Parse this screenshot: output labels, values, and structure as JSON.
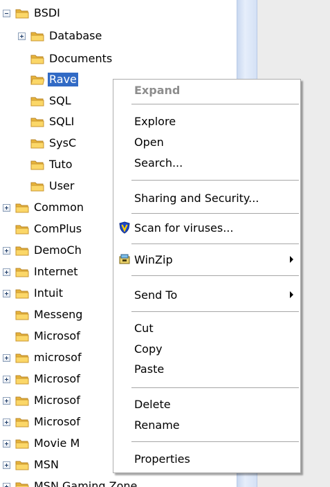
{
  "tree": {
    "items": [
      {
        "label": "BSDI",
        "expander": "minus"
      },
      {
        "label": "Database",
        "expander": "plus"
      },
      {
        "label": "Documents",
        "expander": "none"
      },
      {
        "label": "Rave",
        "expander": "none",
        "selected": true
      },
      {
        "label": "SQL",
        "expander": "none"
      },
      {
        "label": "SQLI",
        "expander": "none"
      },
      {
        "label": "SysC",
        "expander": "none"
      },
      {
        "label": "Tuto",
        "expander": "none"
      },
      {
        "label": "User",
        "expander": "none"
      },
      {
        "label": "Common",
        "expander": "plus"
      },
      {
        "label": "ComPlus",
        "expander": "none"
      },
      {
        "label": "DemoCh",
        "expander": "plus"
      },
      {
        "label": "Internet",
        "expander": "plus"
      },
      {
        "label": "Intuit",
        "expander": "plus"
      },
      {
        "label": "Messeng",
        "expander": "none"
      },
      {
        "label": "Microsof",
        "expander": "none"
      },
      {
        "label": "microsof",
        "expander": "plus"
      },
      {
        "label": "Microsof",
        "expander": "plus"
      },
      {
        "label": "Microsof",
        "expander": "plus"
      },
      {
        "label": "Microsof",
        "expander": "plus"
      },
      {
        "label": "Movie M",
        "expander": "plus"
      },
      {
        "label": "MSN",
        "expander": "plus"
      },
      {
        "label": "MSN Gaming Zone",
        "expander": "plus"
      }
    ]
  },
  "context_menu": {
    "items": [
      {
        "label": "Expand",
        "disabled": true
      },
      {
        "label": "Explore"
      },
      {
        "label": "Open"
      },
      {
        "label": "Search..."
      },
      {
        "label": "Sharing and Security..."
      },
      {
        "label": "Scan for viruses...",
        "icon": "antivirus-shield-icon"
      },
      {
        "label": "WinZip",
        "icon": "winzip-icon",
        "submenu": true
      },
      {
        "label": "Send To",
        "submenu": true
      },
      {
        "label": "Cut"
      },
      {
        "label": "Copy"
      },
      {
        "label": "Paste"
      },
      {
        "label": "Delete"
      },
      {
        "label": "Rename"
      },
      {
        "label": "Properties"
      }
    ]
  },
  "colors": {
    "selection": "#316ac5",
    "folder": "#f5c94a",
    "disabled_text": "#8d8d8d",
    "scroll_strip": "#d4e1f5",
    "right_panel": "#ececec"
  }
}
